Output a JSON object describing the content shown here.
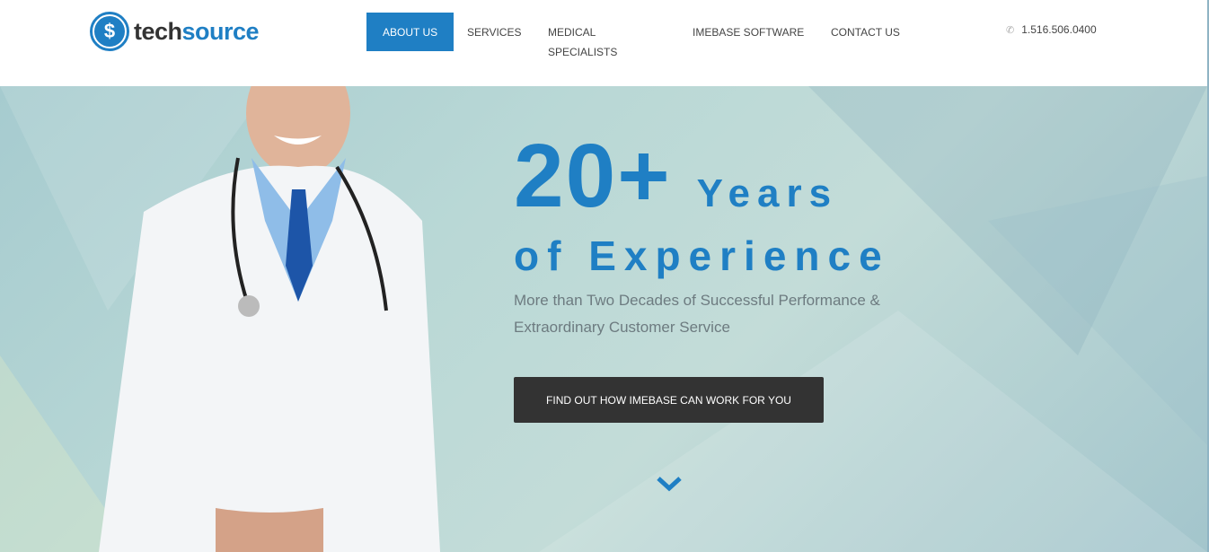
{
  "logo": {
    "mark": "$",
    "text_a": "tech",
    "text_b": "source"
  },
  "nav": [
    {
      "label": "ABOUT US",
      "active": true
    },
    {
      "label": "SERVICES"
    },
    {
      "label": "MEDICAL",
      "label2": "SPECIALISTS"
    },
    {
      "label": "IMEBASE SOFTWARE"
    },
    {
      "label": "CONTACT US"
    }
  ],
  "phone": {
    "icon": "phone-icon",
    "glyph": "✆",
    "number": "1.516.506.0400"
  },
  "hero": {
    "big": "20+",
    "years": "Years",
    "experience": "of Experience",
    "subtitle_1": "More than Two Decades of Successful Performance &",
    "subtitle_2": "Extraordinary Customer Service",
    "cta": "FIND OUT  HOW IMEBASE CAN WORK FOR YOU",
    "scroll_icon": "chevron-down-icon"
  },
  "colors": {
    "accent": "#1f7fc4",
    "button": "#333333"
  }
}
